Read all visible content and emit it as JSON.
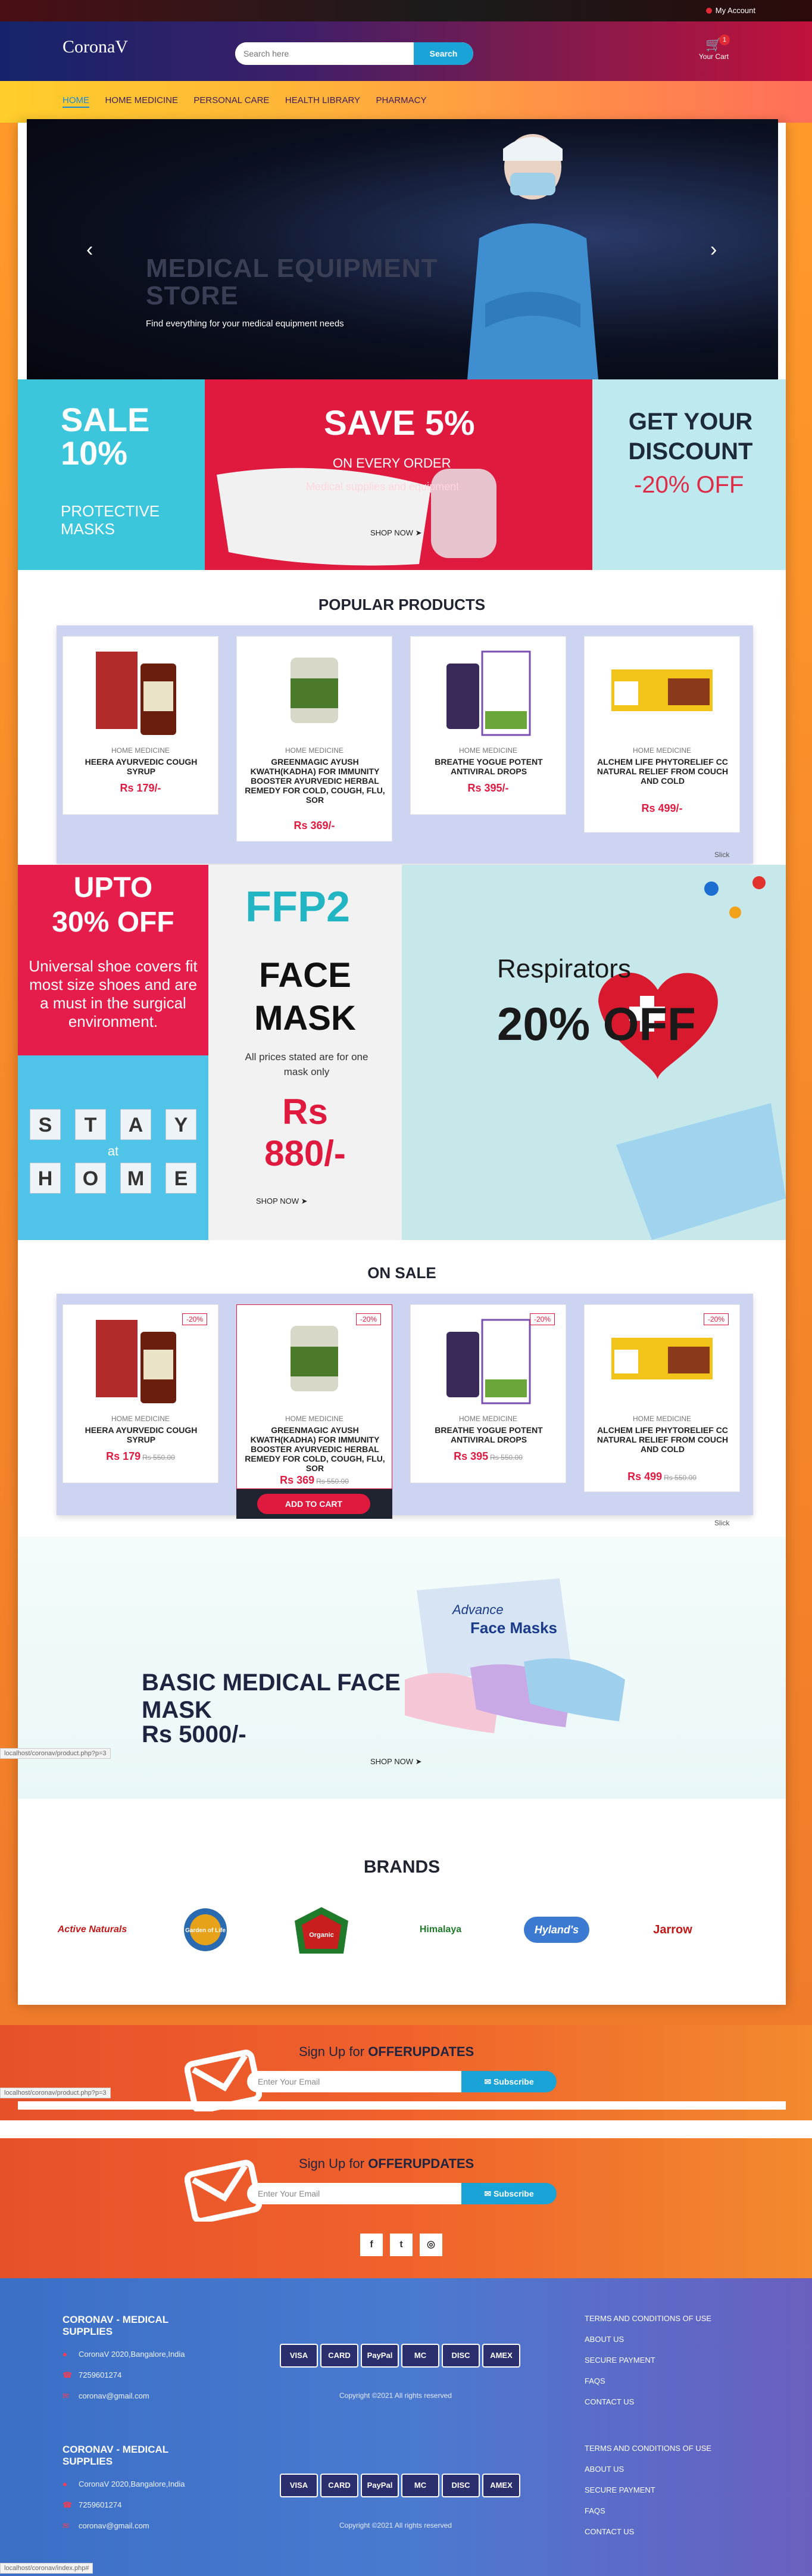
{
  "topbar": {
    "account_label": "My Account"
  },
  "header": {
    "logo": "CoronaV",
    "search_placeholder": "Search here",
    "search_button": "Search",
    "cart_count": "1",
    "cart_label": "Your Cart"
  },
  "nav": {
    "items": [
      "HOME",
      "HOME MEDICINE",
      "PERSONAL CARE",
      "HEALTH LIBRARY",
      "PHARMACY"
    ]
  },
  "hero": {
    "title_line1": "MEDICAL EQUIPMENT",
    "title_line2": "STORE",
    "subtitle": "Find everything for your medical equipment needs",
    "prev": "‹",
    "next": "›"
  },
  "promos": {
    "sale": {
      "line1": "SALE",
      "line2": "10%",
      "line3": "PROTECTIVE",
      "line4": "MASKS"
    },
    "save": {
      "title": "SAVE 5%",
      "on": "ON EVERY ORDER",
      "sub": "Medical supplies and equipment",
      "shop": "SHOP NOW"
    },
    "discount": {
      "title": "GET YOUR DISCOUNT",
      "pct": "-20% OFF"
    }
  },
  "popular": {
    "title": "POPULAR PRODUCTS",
    "products": [
      {
        "category": "HOME MEDICINE",
        "name": "HEERA AYURVEDIC COUGH SYRUP",
        "price": "Rs 179/-"
      },
      {
        "category": "HOME MEDICINE",
        "name": "GREENMAGIC AYUSH KWATH(KADHA) FOR IMMUNITY BOOSTER AYURVEDIC HERBAL REMEDY FOR COLD, COUGH, FLU, SOR",
        "price": "Rs 369/-"
      },
      {
        "category": "HOME MEDICINE",
        "name": "BREATHE YOGUE POTENT ANTIVIRAL DROPS",
        "price": "Rs 395/-"
      },
      {
        "category": "HOME MEDICINE",
        "name": "ALCHEM LIFE PHYTORELIEF CC NATURAL RELIEF FROM COUCH AND COLD",
        "price": "Rs 499/-"
      }
    ],
    "watermark": "Slick"
  },
  "bigpromo": {
    "upto": "UPTO 30% OFF",
    "shoe": "Universal shoe covers fit most size shoes and are a must in the surgical environment.",
    "stay": [
      "S",
      "T",
      "A",
      "Y"
    ],
    "at": "at",
    "home": [
      "H",
      "O",
      "M",
      "E"
    ],
    "ffp2": "FFP2",
    "face_mask": "FACE MASK",
    "note": "All prices stated are for one mask only",
    "rs_label": "Rs",
    "rs_value": "880/-",
    "shop": "SHOP NOW",
    "respirators": "Respirators",
    "respirators_pct": "20% OFF"
  },
  "onsale": {
    "title": "ON SALE",
    "products": [
      {
        "category": "HOME MEDICINE",
        "name": "HEERA AYURVEDIC COUGH SYRUP",
        "price": "Rs 179",
        "old": "Rs 550.00",
        "discount": "-20%"
      },
      {
        "category": "HOME MEDICINE",
        "name": "GREENMAGIC AYUSH KWATH(KADHA) FOR IMMUNITY BOOSTER AYURVEDIC HERBAL REMEDY FOR COLD, COUGH, FLU, SOR",
        "price": "Rs 369",
        "old": "Rs 550.00",
        "discount": "-20%"
      },
      {
        "category": "HOME MEDICINE",
        "name": "BREATHE YOGUE POTENT ANTIVIRAL DROPS",
        "price": "Rs 395",
        "old": "Rs 550.00",
        "discount": "-20%"
      },
      {
        "category": "HOME MEDICINE",
        "name": "ALCHEM LIFE PHYTORELIEF CC NATURAL RELIEF FROM COUCH AND COLD",
        "price": "Rs 499",
        "old": "Rs 550.00",
        "discount": "-20%"
      }
    ],
    "add_to_cart": "ADD TO CART",
    "watermark": "Slick"
  },
  "maskbanner": {
    "title_line1": "BASIC MEDICAL FACE",
    "title_line2": "MASK",
    "price": "Rs 5000/-",
    "shop": "SHOP NOW",
    "box_brand": "Advance",
    "box_text": "Face Masks"
  },
  "brands": {
    "title": "BRANDS",
    "items": [
      "Active Naturals",
      "Garden of Life",
      "Organic",
      "Himalaya",
      "Hyland's",
      "Jarrow"
    ]
  },
  "signup": {
    "prefix": "Sign Up for",
    "highlight": "OFFERUPDATES",
    "placeholder": "Enter Your Email",
    "button": "Subscribe"
  },
  "social": {
    "facebook": "f",
    "twitter": "t",
    "instagram": "◎"
  },
  "footer": {
    "title_line1": "CORONAV - MEDICAL",
    "title_line2": "SUPPLIES",
    "address": "CoronaV 2020,Bangalore,India",
    "phone": "7259601274",
    "email": "coronav@gmail.com",
    "payment_cards": [
      "VISA",
      "CARD",
      "PayPal",
      "MC",
      "DISC",
      "AMEX"
    ],
    "copyright": "Copyright ©2021 All rights reserved",
    "links": [
      "TERMS AND CONDITIONS OF USE",
      "ABOUT US",
      "SECURE PAYMENT",
      "FAQS",
      "CONTACT US"
    ]
  },
  "status": {
    "url1": "localhost/coronav/product.php?p=3",
    "url2": "localhost/coronav/index.php#"
  }
}
